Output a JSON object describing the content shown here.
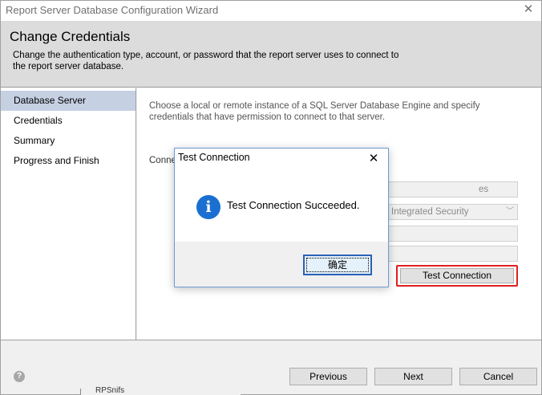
{
  "window": {
    "title": "Report Server Database Configuration Wizard",
    "close_glyph": "✕"
  },
  "header": {
    "title": "Change Credentials",
    "description": "Change the authentication type, account, or password that the report server uses to connect to the report server database."
  },
  "nav": {
    "items": [
      {
        "label": "Database Server",
        "active": true
      },
      {
        "label": "Credentials",
        "active": false
      },
      {
        "label": "Summary",
        "active": false
      },
      {
        "label": "Progress and Finish",
        "active": false
      }
    ]
  },
  "content": {
    "intro": "Choose a local or remote instance of a SQL Server Database Engine and specify credentials that have permission to connect to that server.",
    "connection_label_partial": "Conne",
    "fields": [
      {
        "visible_text": "es"
      },
      {
        "visible_text": "Integrated Security",
        "chevron": "﹀"
      },
      {
        "visible_text": ""
      },
      {
        "visible_text": ""
      }
    ],
    "test_connection_label": "Test Connection"
  },
  "footer": {
    "help_glyph": "?",
    "previous_label": "Previous",
    "next_label": "Next",
    "cancel_label": "Cancel"
  },
  "background": {
    "partial_text": "RPSnifs"
  },
  "dialog": {
    "title": "Test Connection",
    "close_glyph": "✕",
    "icon_glyph": "i",
    "message": "Test Connection Succeeded.",
    "ok_label": "确定"
  }
}
